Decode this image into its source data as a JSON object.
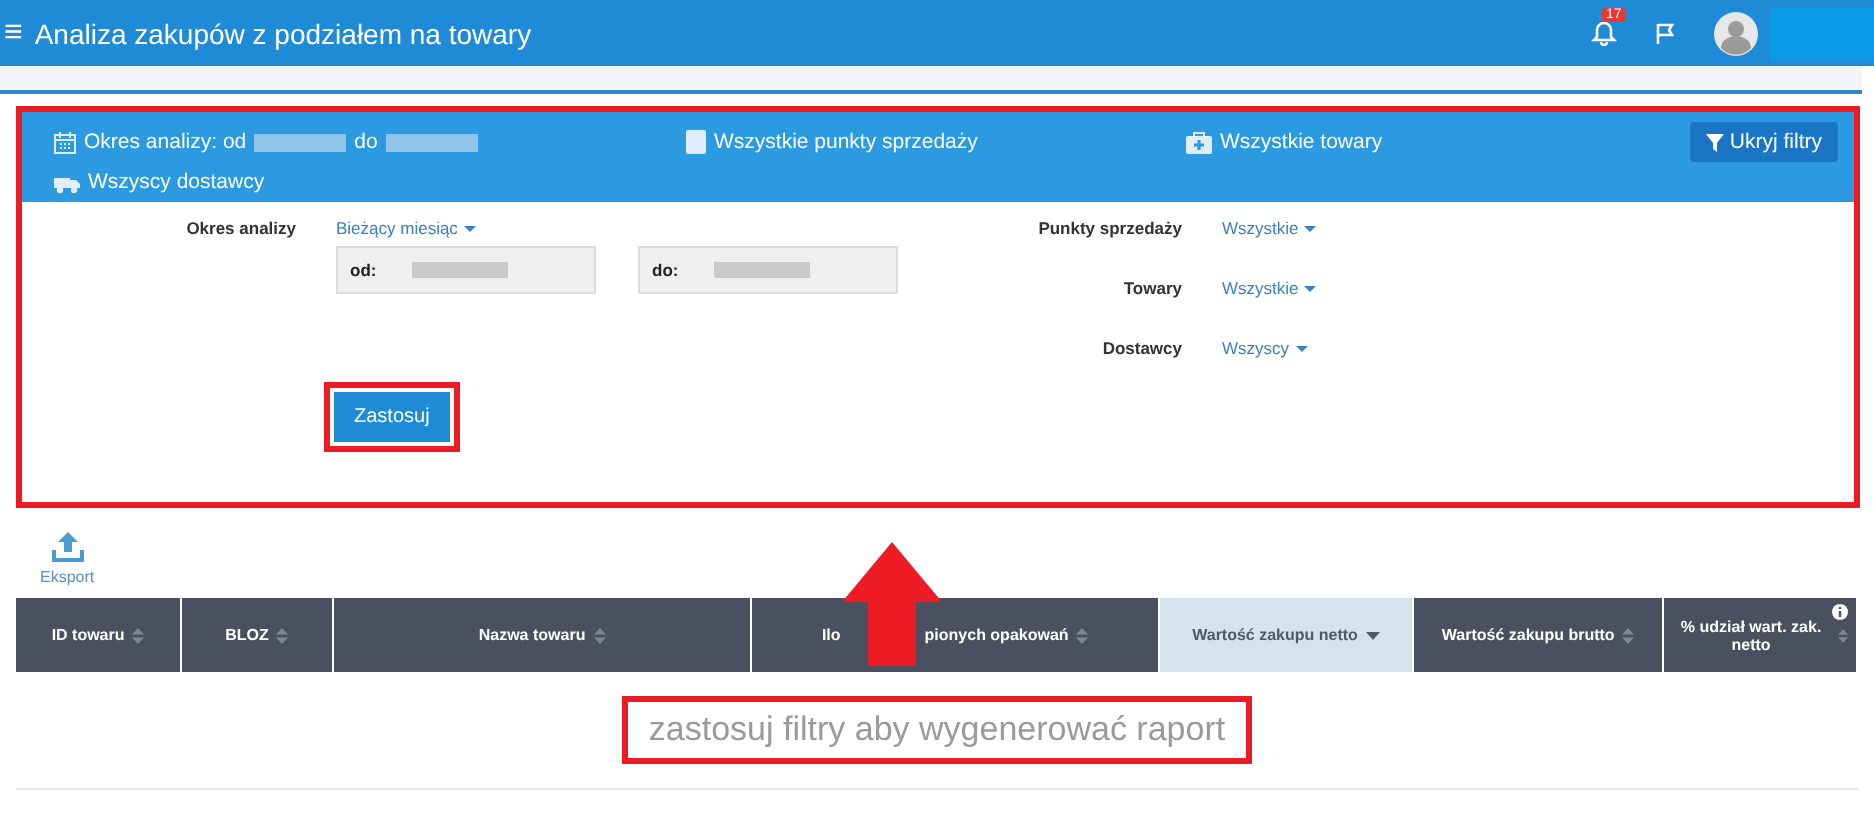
{
  "topbar": {
    "menu_icon": "≡",
    "title": "Analiza zakupów z podziałem na towary",
    "notification_count": "17"
  },
  "filter_summary": {
    "period_label": "Okres analizy: od",
    "period_to": "do",
    "points": "Wszystkie punkty sprzedaży",
    "goods": "Wszystkie towary",
    "suppliers": "Wszyscy dostawcy",
    "hide_button": "Ukryj filtry"
  },
  "filters": {
    "period": {
      "label": "Okres analizy",
      "dropdown": "Bieżący miesiąc",
      "from_label": "od:",
      "to_label": "do:"
    },
    "right": [
      {
        "label": "Punkty sprzedaży",
        "value": "Wszystkie"
      },
      {
        "label": "Towary",
        "value": "Wszystkie"
      },
      {
        "label": "Dostawcy",
        "value": "Wszyscy"
      }
    ],
    "apply_button": "Zastosuj"
  },
  "export": {
    "label": "Eksport"
  },
  "table": {
    "columns": [
      {
        "label": "ID towaru",
        "selected": false
      },
      {
        "label": "BLOZ",
        "selected": false
      },
      {
        "label": "Nazwa towaru",
        "selected": false
      },
      {
        "label": "Ilo",
        "label_tail": "pionych opakowań",
        "selected": false
      },
      {
        "label": "Wartość zakupu netto",
        "selected": true
      },
      {
        "label": "Wartość zakupu brutto",
        "selected": false
      },
      {
        "label": "% udział wart. zak. netto",
        "selected": false,
        "info": true
      }
    ],
    "empty_message": "zastosuj filtry aby wygenerować raport"
  }
}
